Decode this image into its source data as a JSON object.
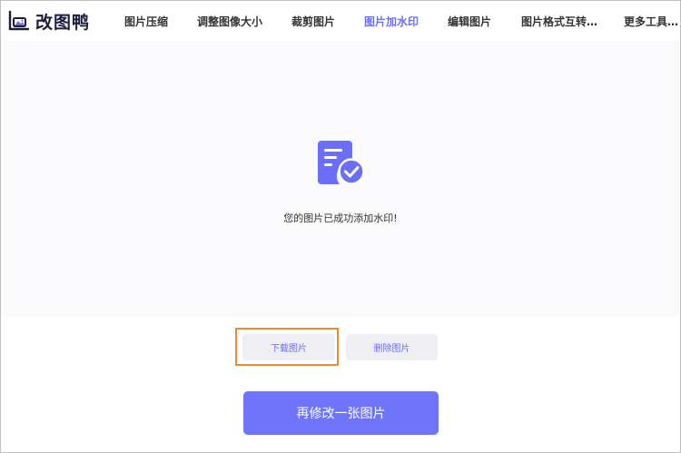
{
  "app": {
    "logo_text": "改图鸭"
  },
  "nav": {
    "items": [
      {
        "label": "图片压缩"
      },
      {
        "label": "调整图像大小"
      },
      {
        "label": "裁剪图片"
      },
      {
        "label": "图片加水印",
        "active": true
      },
      {
        "label": "编辑图片"
      },
      {
        "label": "图片格式互转…"
      },
      {
        "label": "更多工具…"
      }
    ]
  },
  "main": {
    "success_icon": "document-check-icon",
    "success_message": "您的图片已成功添加水印!"
  },
  "actions": {
    "download_label": "下载图片",
    "delete_label": "删除图片",
    "modify_another_label": "再修改一张图片"
  },
  "colors": {
    "accent": "#6a6ef8",
    "primary_button": "#6e75fb",
    "highlight_border": "#f0892b",
    "content_bg": "#fafafc",
    "secondary_button_bg": "#eeeef3"
  }
}
